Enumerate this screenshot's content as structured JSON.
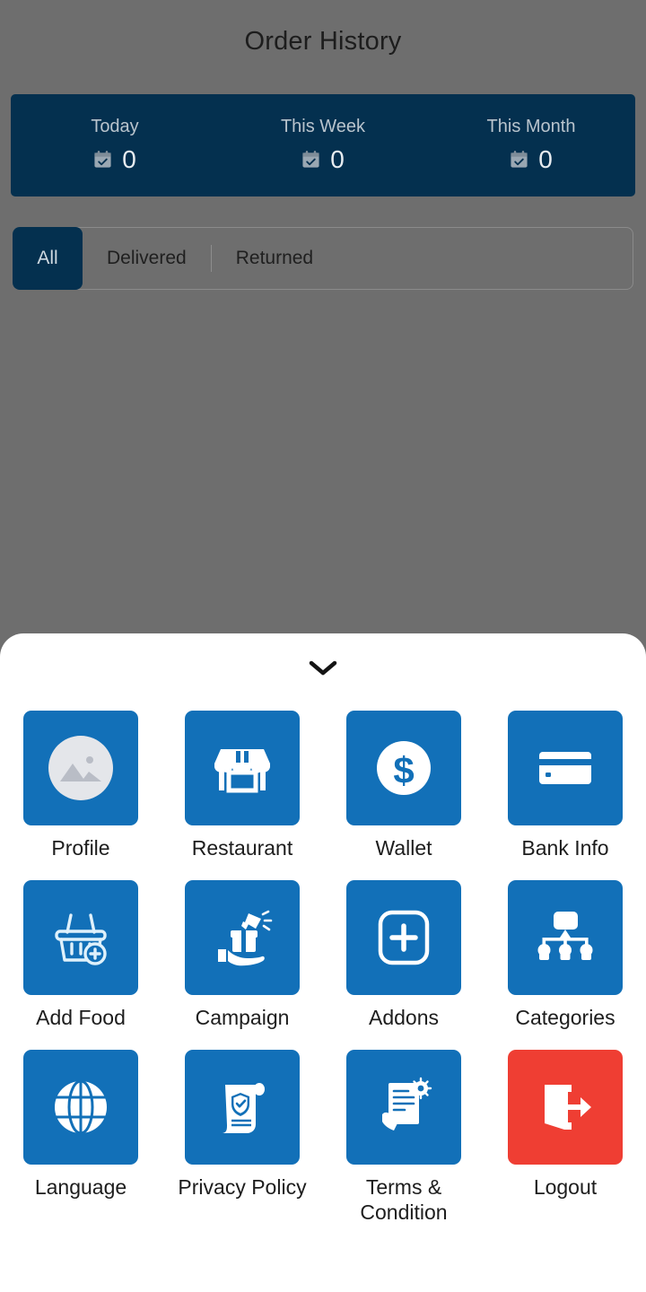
{
  "header": {
    "title": "Order History"
  },
  "stats": {
    "icon": "calendar-check-icon",
    "items": [
      {
        "label": "Today",
        "value": "0"
      },
      {
        "label": "This Week",
        "value": "0"
      },
      {
        "label": "This Month",
        "value": "0"
      }
    ]
  },
  "filters": {
    "tabs": [
      {
        "label": "All",
        "active": true
      },
      {
        "label": "Delivered",
        "active": false
      },
      {
        "label": "Returned",
        "active": false
      }
    ]
  },
  "sheet": {
    "handle_icon": "chevron-down-icon",
    "menu": [
      {
        "label": "Profile",
        "icon": "image-placeholder-icon"
      },
      {
        "label": "Restaurant",
        "icon": "storefront-icon"
      },
      {
        "label": "Wallet",
        "icon": "dollar-coin-icon"
      },
      {
        "label": "Bank Info",
        "icon": "credit-card-icon"
      },
      {
        "label": "Add Food",
        "icon": "basket-plus-icon"
      },
      {
        "label": "Campaign",
        "icon": "megaphone-gift-hand-icon"
      },
      {
        "label": "Addons",
        "icon": "plus-square-icon"
      },
      {
        "label": "Categories",
        "icon": "hierarchy-icon"
      },
      {
        "label": "Language",
        "icon": "globe-icon"
      },
      {
        "label": "Privacy Policy",
        "icon": "scroll-shield-icon"
      },
      {
        "label": "Terms & Condition",
        "icon": "document-signing-icon"
      },
      {
        "label": "Logout",
        "icon": "exit-door-icon"
      }
    ]
  },
  "colors": {
    "primary_blue": "#1270b8",
    "navy": "#04304f",
    "danger_red": "#ef3e33",
    "scrim_gray": "#6e6e6e",
    "sheet_white": "#ffffff"
  }
}
